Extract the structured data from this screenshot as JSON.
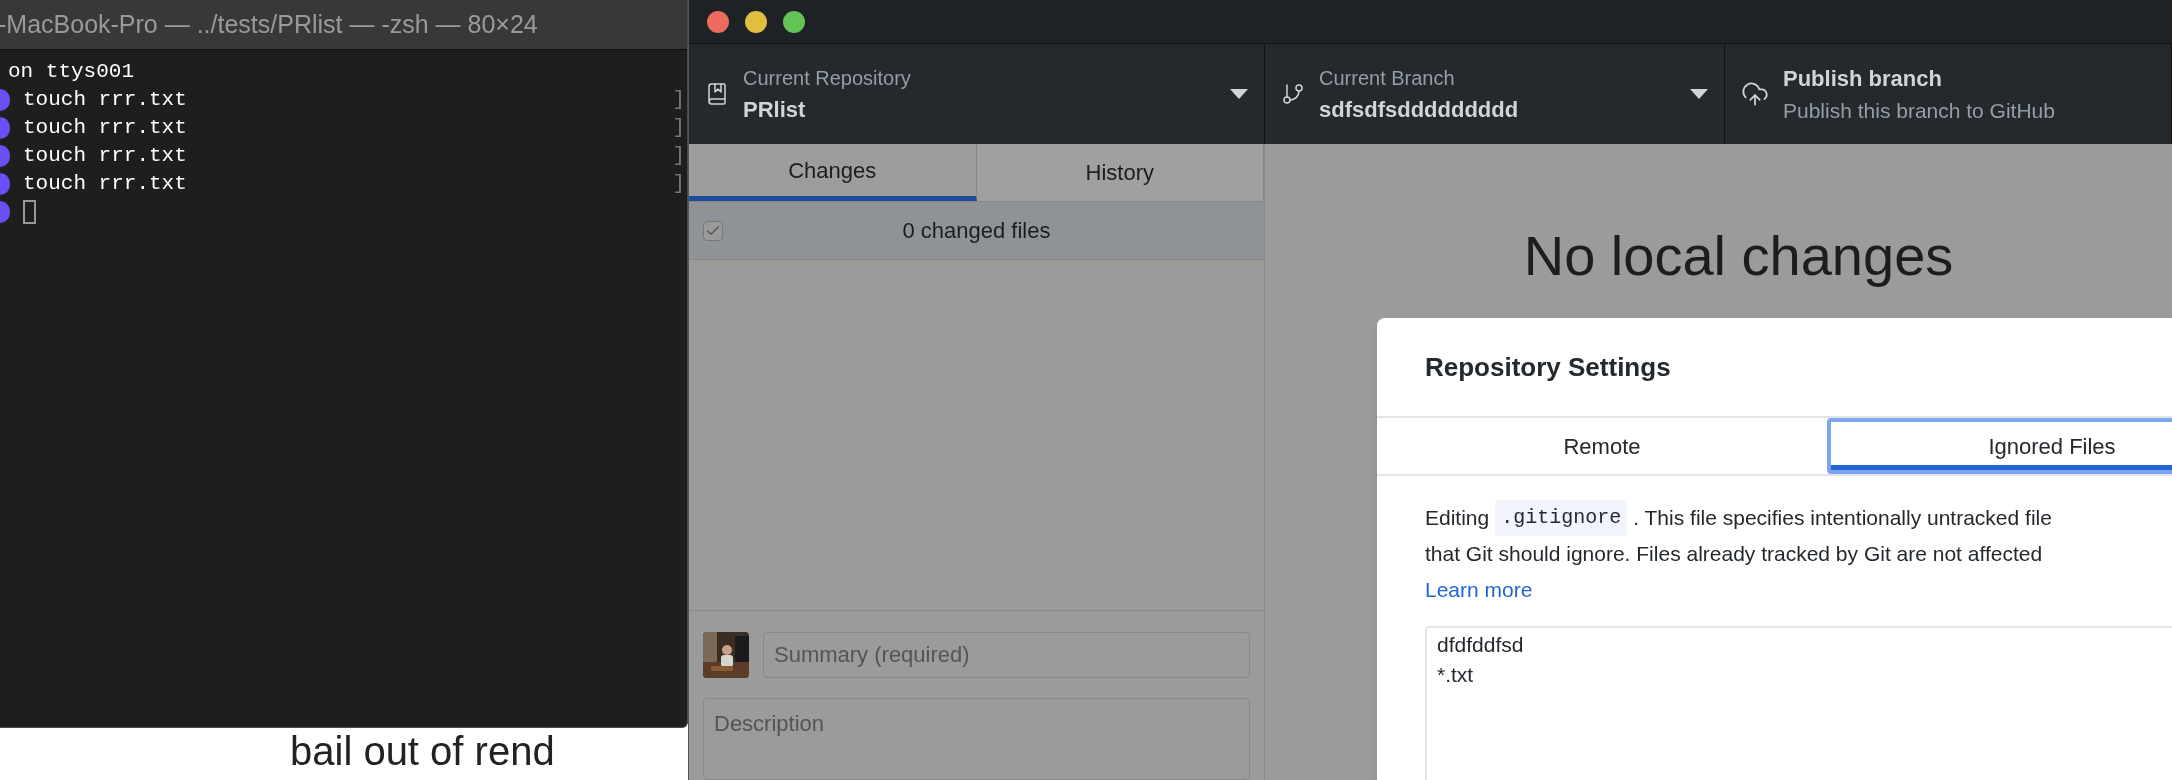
{
  "terminal": {
    "title": "-MacBook-Pro — ../tests/PRlist — -zsh — 80×24",
    "lines": [
      {
        "kind": "output",
        "text": "on ttys001"
      },
      {
        "kind": "command",
        "text": "touch rrr.txt",
        "right_mark": "]"
      },
      {
        "kind": "command",
        "text": "touch rrr.txt",
        "right_mark": "]"
      },
      {
        "kind": "command",
        "text": "touch rrr.txt",
        "right_mark": "]"
      },
      {
        "kind": "command",
        "text": "touch rrr.txt",
        "right_mark": "]"
      },
      {
        "kind": "prompt"
      }
    ]
  },
  "backdrop_text": "bail out of rend",
  "window": {
    "toolbar": [
      {
        "kind": "repository",
        "label": "Current Repository",
        "value": "PRlist"
      },
      {
        "kind": "branch",
        "label": "Current Branch",
        "value": "sdfsdfsddddddddd"
      },
      {
        "kind": "publish",
        "label": "Publish branch",
        "value": "Publish this branch to GitHub"
      }
    ],
    "sidebar": {
      "tabs": [
        {
          "label": "Changes",
          "selected": true
        },
        {
          "label": "History",
          "selected": false
        }
      ],
      "changes": {
        "label": "0 changed files",
        "checked": true
      },
      "summary": {
        "placeholder": "Summary (required)"
      },
      "description": {
        "placeholder": "Description"
      }
    },
    "empty_state": "No local changes",
    "dialog": {
      "title": "Repository Settings",
      "tabs": [
        {
          "label": "Remote",
          "selected": false
        },
        {
          "label": "Ignored Files",
          "selected": true
        }
      ],
      "intro": {
        "before": "Editing",
        "file": ".gitignore",
        "after": ". This file specifies intentionally untracked file"
      },
      "intro_line_2": "that Git should ignore. Files already tracked by Git are not affected",
      "link": "Learn more",
      "ignore_lines": [
        "dfdfddfsd",
        "*.txt"
      ]
    }
  }
}
